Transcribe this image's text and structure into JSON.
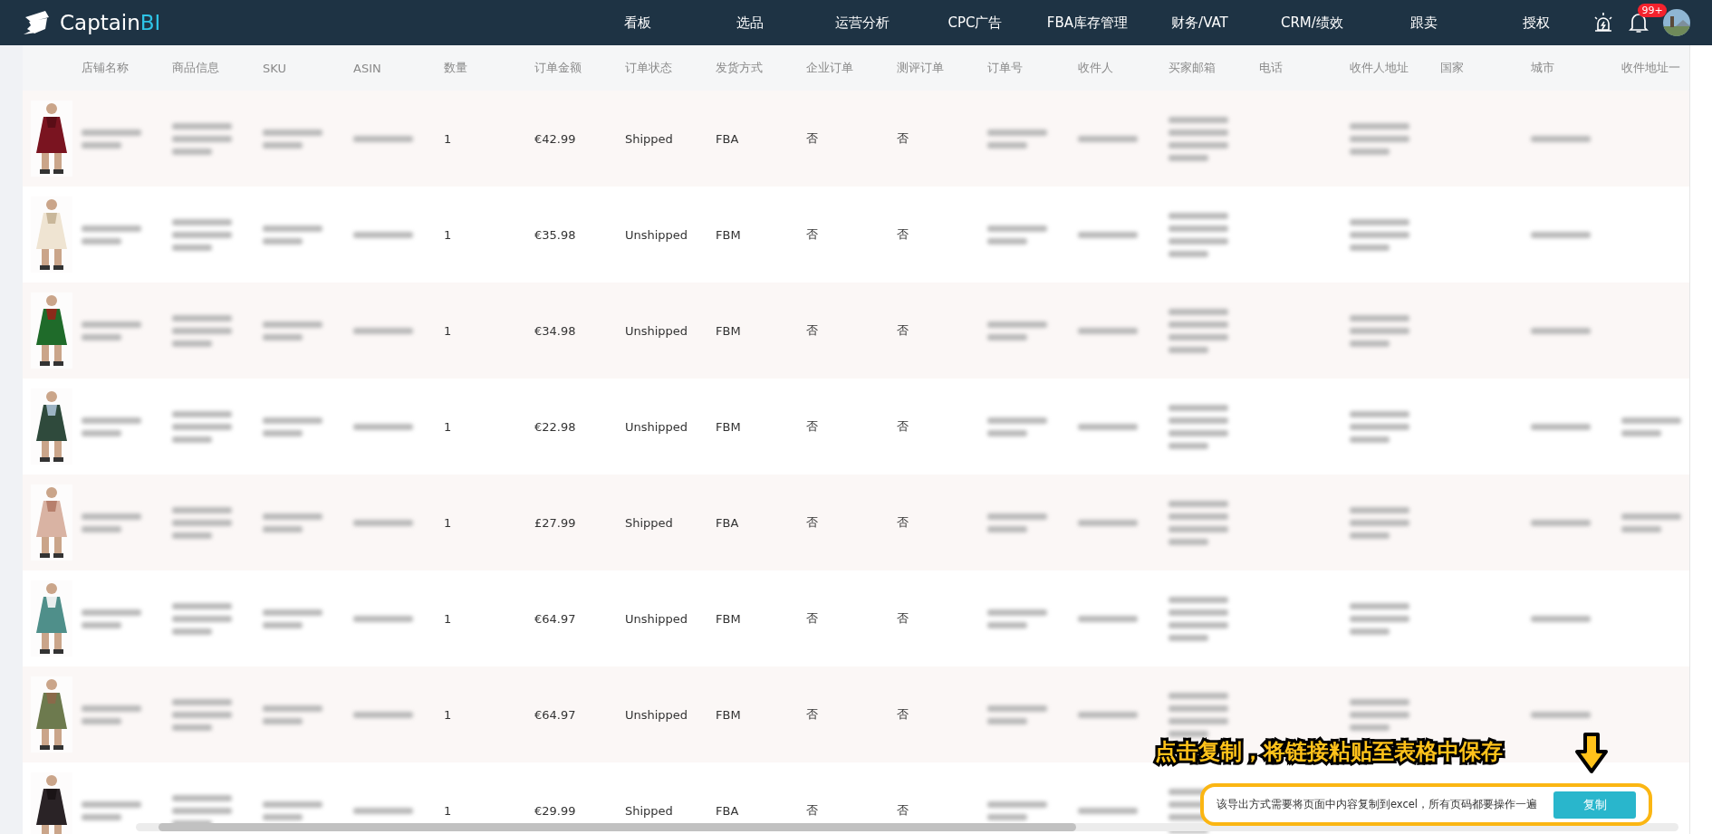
{
  "logo": {
    "name": "Captain",
    "accent": "BI"
  },
  "nav": [
    {
      "label": "看板"
    },
    {
      "label": "选品"
    },
    {
      "label": "运营分析"
    },
    {
      "label": "CPC广告"
    },
    {
      "label": "FBA库存管理"
    },
    {
      "label": "财务/VAT"
    },
    {
      "label": "CRM/绩效"
    },
    {
      "label": "跟卖"
    },
    {
      "label": "授权"
    }
  ],
  "notifications": {
    "badge": "99+"
  },
  "table": {
    "columns": [
      "店铺名称",
      "商品信息",
      "SKU",
      "ASIN",
      "数量",
      "订单金额",
      "订单状态",
      "发货方式",
      "企业订单",
      "测评订单",
      "订单号",
      "收件人",
      "买家邮箱",
      "电话",
      "收件人地址",
      "国家",
      "城市",
      "收件地址一"
    ],
    "rows": [
      {
        "quantity": "1",
        "amount": "€42.99",
        "status": "Shipped",
        "shipping": "FBA",
        "business_order": "否",
        "review_order": "否"
      },
      {
        "quantity": "1",
        "amount": "€35.98",
        "status": "Unshipped",
        "shipping": "FBM",
        "business_order": "否",
        "review_order": "否"
      },
      {
        "quantity": "1",
        "amount": "€34.98",
        "status": "Unshipped",
        "shipping": "FBM",
        "business_order": "否",
        "review_order": "否"
      },
      {
        "quantity": "1",
        "amount": "€22.98",
        "status": "Unshipped",
        "shipping": "FBM",
        "business_order": "否",
        "review_order": "否"
      },
      {
        "quantity": "1",
        "amount": "£27.99",
        "status": "Shipped",
        "shipping": "FBA",
        "business_order": "否",
        "review_order": "否"
      },
      {
        "quantity": "1",
        "amount": "€64.97",
        "status": "Unshipped",
        "shipping": "FBM",
        "business_order": "否",
        "review_order": "否"
      },
      {
        "quantity": "1",
        "amount": "€64.97",
        "status": "Unshipped",
        "shipping": "FBM",
        "business_order": "否",
        "review_order": "否"
      },
      {
        "quantity": "1",
        "amount": "€29.99",
        "status": "Shipped",
        "shipping": "FBA",
        "business_order": "否",
        "review_order": "否"
      }
    ]
  },
  "annotation": {
    "callout": "点击复制，将链接粘贴至表格中保存",
    "tip": "该导出方式需要将页面中内容复制到excel，所有页码都要操作一遍",
    "button": "复制"
  }
}
